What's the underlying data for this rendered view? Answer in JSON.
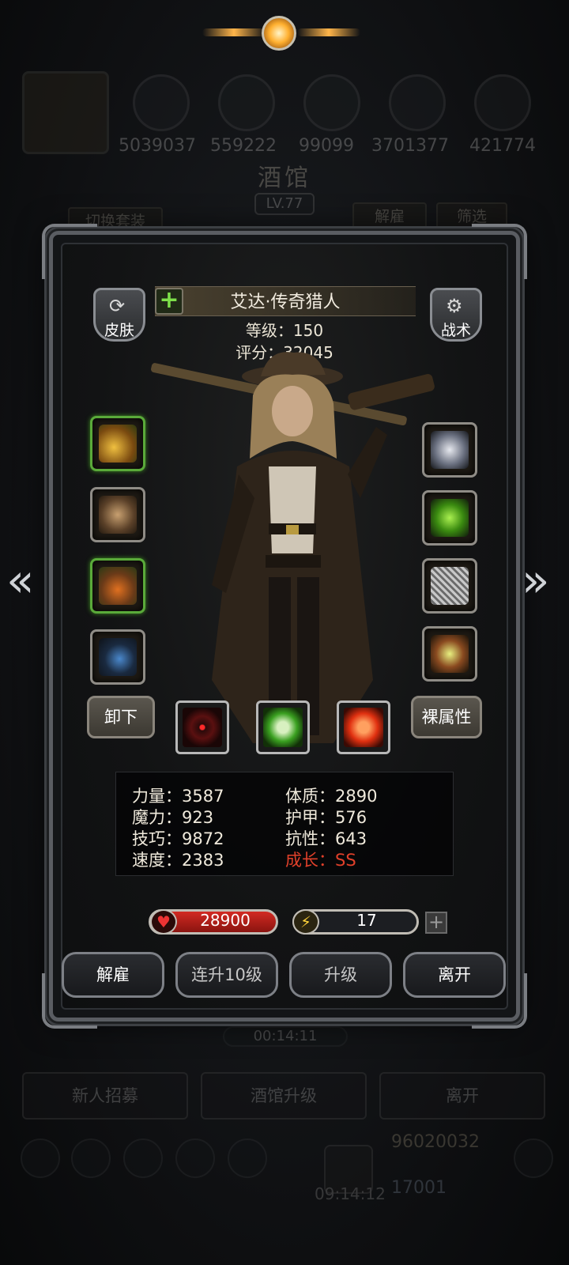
{
  "background": {
    "resources": [
      "5039037",
      "559222",
      "99099",
      "3701377",
      "421774"
    ],
    "screen_title": "酒馆",
    "screen_level": "LV.77",
    "switch_outfit_label": "切换套装",
    "dismiss_label": "解雇",
    "filter_label": "筛选",
    "timer": "00:14:11",
    "bottom_buttons": [
      "新人招募",
      "酒馆升级",
      "离开"
    ],
    "gold": "96020032",
    "gems": "17001",
    "clock": "09:14:12"
  },
  "hero": {
    "name": "艾达·传奇猎人",
    "level_text": "等级：150",
    "score_text": "评分：32045",
    "skin_label": "皮肤",
    "tactics_label": "战术",
    "skin_icon": "refresh-icon",
    "tactics_icon": "gear-icon"
  },
  "equipment": {
    "left": [
      "golden-gun-icon",
      "armor-icon",
      "crown-icon",
      "amulet-icon"
    ],
    "right": [
      "ring-icon",
      "green-gem-icon",
      "chainmail-icon",
      "lantern-icon"
    ]
  },
  "actions": {
    "unequip_label": "卸下",
    "base_attr_label": "裸属性",
    "skills": [
      "target-icon",
      "green-skull-icon",
      "red-cross-icon"
    ]
  },
  "stats": {
    "strength": "力量：3587",
    "magic": "魔力：923",
    "skill": "技巧：9872",
    "speed": "速度：2383",
    "constitution": "体质：2890",
    "armor": "护甲：576",
    "resistance": "抗性：643",
    "growth": "成长：SS"
  },
  "bars": {
    "hp": "28900",
    "energy": "17",
    "energy_fill_fraction": 0.12
  },
  "buttons": {
    "dismiss": "解雇",
    "level_up_10": "连升10级",
    "level_up": "升级",
    "leave": "离开"
  },
  "colors": {
    "accent_green": "#7de04a",
    "growth_red": "#e0402a",
    "hp_red": "#d22a22",
    "energy_yellow": "#f0d040"
  }
}
